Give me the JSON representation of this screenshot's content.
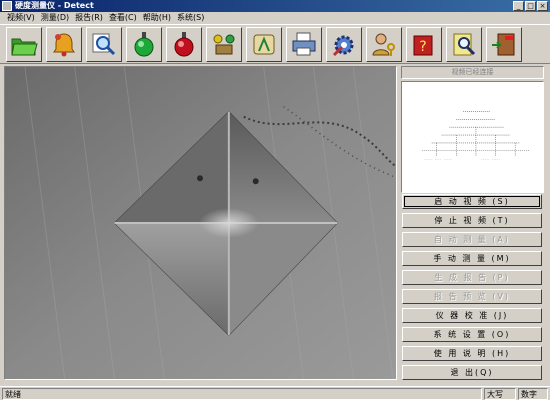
{
  "window": {
    "title": "硬度测量仪 - Detect",
    "minimize_glyph": "_",
    "maximize_glyph": "□",
    "close_glyph": "×"
  },
  "menu": [
    "视频(V)",
    "测量(D)",
    "报告(R)",
    "查看(C)",
    "帮助(H)",
    "系统(S)"
  ],
  "toolbar_icons": [
    "open-folder-icon",
    "alarm-bell-icon",
    "zoom-magnifier-icon",
    "green-light-icon",
    "red-light-icon",
    "tools-icon",
    "calibration-icon",
    "print-report-icon",
    "settings-gear-icon",
    "user-key-icon",
    "help-book-icon",
    "search-document-icon",
    "exit-door-icon"
  ],
  "video_status": "视频已经连接",
  "buttons": [
    {
      "label": "启 动 视 频 (S)",
      "enabled": true,
      "focused": true
    },
    {
      "label": "停 止 视 频 (T)",
      "enabled": true,
      "focused": false
    },
    {
      "label": "自 动 测 量 (A)",
      "enabled": false,
      "focused": false
    },
    {
      "label": "手 动 测 量 (M)",
      "enabled": true,
      "focused": false
    },
    {
      "label": "生 成 报 告 (P)",
      "enabled": false,
      "focused": false
    },
    {
      "label": "报 告 预 览 (V)",
      "enabled": false,
      "focused": false
    },
    {
      "label": "仪 器 校 准 (J)",
      "enabled": true,
      "focused": false
    },
    {
      "label": "系 统 设 置 (O)",
      "enabled": true,
      "focused": false
    },
    {
      "label": "使 用 说 明 (H)",
      "enabled": true,
      "focused": false
    },
    {
      "label": "退        出(Q)",
      "enabled": true,
      "focused": false
    }
  ],
  "status": {
    "message": "就绪",
    "caps": "大写",
    "num": "数字"
  }
}
